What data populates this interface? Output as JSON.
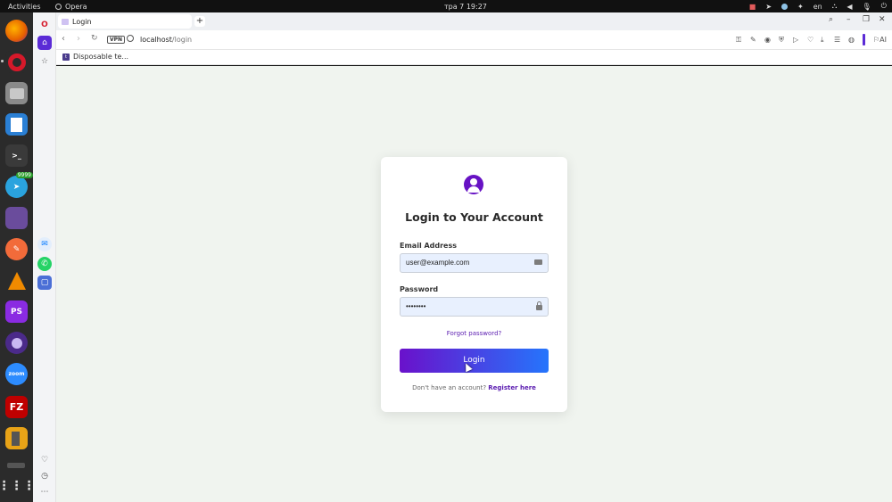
{
  "topbar": {
    "activities": "Activities",
    "app_name": "Opera",
    "clock": "тра 7  19:27",
    "language": "en"
  },
  "dock": {
    "items": [
      {
        "name": "firefox",
        "color": "#e66000"
      },
      {
        "name": "opera",
        "color": "#d6192a"
      },
      {
        "name": "files",
        "color": "#777777"
      },
      {
        "name": "libreoffice-writer",
        "color": "#2a7fd4"
      },
      {
        "name": "terminal",
        "color": "#3a3a3a",
        "label": ">_"
      },
      {
        "name": "telegram",
        "color": "#2aa3de",
        "badge": "9999"
      },
      {
        "name": "video-editor",
        "color": "#6a4c9c"
      },
      {
        "name": "postman",
        "color": "#f26b3a"
      },
      {
        "name": "vlc",
        "color": "#f08a00"
      },
      {
        "name": "phpstorm",
        "color": "#8a2be2",
        "label": "PS"
      },
      {
        "name": "tor-browser",
        "color": "#4b2a8a"
      },
      {
        "name": "zoom",
        "color": "#2d8cff",
        "label": "zoom"
      },
      {
        "name": "filezilla",
        "color": "#bf0000",
        "label": "FZ"
      },
      {
        "name": "calculator",
        "color": "#e8a317"
      },
      {
        "name": "app-grid",
        "color": "#2b2b2b"
      }
    ]
  },
  "browser": {
    "tab_title": "Login",
    "new_tab": "+",
    "vpn": "VPN",
    "url_host": "localhost",
    "url_path": "/login",
    "ai_label": "AI",
    "bookmark": "Disposable te..."
  },
  "login": {
    "title": "Login to Your Account",
    "email_label": "Email Address",
    "email_value": "user@example.com",
    "password_label": "Password",
    "password_value": "••••••••",
    "forgot": "Forgot password?",
    "login_button": "Login",
    "register_prompt": "Don't have an account?",
    "register_link": "Register here"
  },
  "colors": {
    "accent": "#6a11cb",
    "accent_end": "#2575fc",
    "page_bg": "#f0f4ef"
  }
}
